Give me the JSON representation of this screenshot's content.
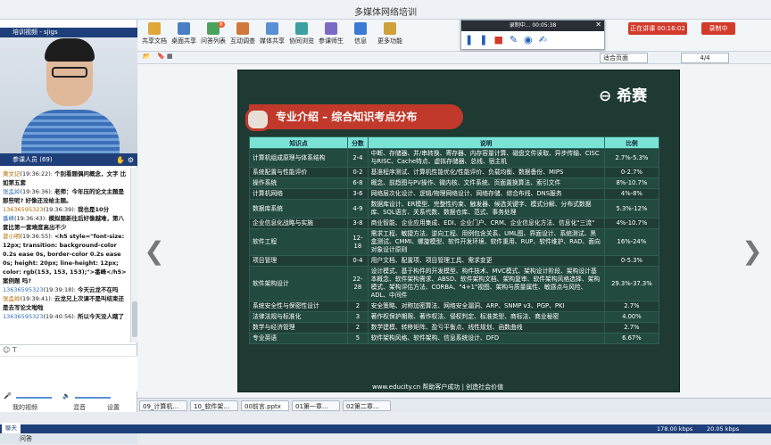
{
  "window": {
    "title": "多媒体网络培训"
  },
  "left_panel": {
    "video_title": "培训视频 - sjigs",
    "attendees_label": "参课人员 (69)",
    "chat": [
      {
        "name": "黄文记",
        "time": "(19:36:22):",
        "text": "个别看题偶问概念，文字 比如第五套"
      },
      {
        "name": "张孟岭",
        "time": "(19:36:36):",
        "text": "老师：今年压的论文主题是那些呢? 好像还没给主题。"
      },
      {
        "name": "13636595323",
        "time": "(19:36:39):",
        "text": "我也是10分"
      },
      {
        "name": "番峰",
        "time": "(19:36:43):",
        "text": "模拟题新往后好像越难，第八套比第一套难度高出不少"
      },
      {
        "name": "曾小明",
        "time": "(19:36:55):",
        "text": "<h5 style=\"font-size: 12px; transition: background-color 0.2s ease 0s, border-color 0.2s ease 0s; height: 20px; line-height: 12px; color: rgb(153, 153, 153);\">番峰</h5>案例题 吗?"
      },
      {
        "name": "13636595323",
        "time": "(19:39:18):",
        "text": "今天云龙不在吗"
      },
      {
        "name": "张孟岭",
        "time": "(19:39:41):",
        "text": "云龙兄上次课不是叫结束还是去写论文啦啦"
      },
      {
        "name": "13636595323",
        "time": "(19:40:56):",
        "text": "所以今天没人瞎了"
      }
    ],
    "input_icons": "☺ T",
    "my_video": "我的视频",
    "mix": "混音",
    "settings": "设置",
    "qa": "问答",
    "chat_tab": "聊天"
  },
  "toolbar": {
    "buttons": [
      "共享文档",
      "桌面共享",
      "问答列表",
      "互动调查",
      "媒体共享",
      "协同浏览",
      "参课师生",
      "信息",
      "更多功能"
    ],
    "badge": "8",
    "record_bar": "录制中... 00:05:38",
    "live_label": "正在讲课 00:16:02",
    "record_label": "录制中"
  },
  "nav": {
    "zoom": "适合页面",
    "page": "4/4"
  },
  "slide": {
    "logo": "希赛",
    "title": "专业介绍 – 综合知识考点分布",
    "headers": [
      "知识点",
      "分数",
      "说明",
      "比例"
    ],
    "rows": [
      [
        "计算机组成原理与体系结构",
        "2-4",
        "中断、存储器、并/串转换、寄存器、内存容量计算、磁盘文件读取、异步传输、CISC与RISC、Cache特点、虚拟存储器、总线、宿主机",
        "2.7%-5.3%"
      ],
      [
        "系统配置与性能评价",
        "0-2",
        "基准程序测试、计算机性能优化/性能评价、负载均衡、数据备份、MIPS",
        "0-2.7%"
      ],
      [
        "操作系统",
        "6-8",
        "概念、前趋图与PV操作、微内核、文件系统、页面置换算法、索引文件",
        "8%-10.7%"
      ],
      [
        "计算机网络",
        "3-6",
        "网络层次化设计、逻辑/物理网络设计、网络存储、综合布线、DNS服务",
        "4%-8%"
      ],
      [
        "数据库系统",
        "4-9",
        "数据库设计、ER模型、完整性约束、触发器、候选关键字、模式分解、分布式数据库、SQL语言、关系代数、数据仓库、范式、事务处理",
        "5.3%-12%"
      ],
      [
        "企业信息化战略与实施",
        "3-8",
        "商业智能、企业应用集成、EDI、企业门户、CRM、企业信息化方法、信息化\"三流\"",
        "4%-10.7%"
      ],
      [
        "软件工程",
        "12-18",
        "需求工程、敏捷方法、逆向工程、用例包含关系、UML图、界面设计、系统测试、黑盒测试、CMMI、螺旋模型、软件开发环境、软件重用、RUP、软件维护、RAD、面向对象设计原则",
        "16%-24%"
      ],
      [
        "项目管理",
        "0-4",
        "用户文档、配置项、项目管理工具、需求变更",
        "0-5.3%"
      ],
      [
        "软件架构设计",
        "22-28",
        "设计模式、基于构件的开发模型、构件技术、MVC模式、架构设计阶段、架构设计基本概念、软件架构需求、ABSD、软件架构文档、架构复审、软件架构风格选择、架构模式、架构评估方法、CORBA、\"4+1\"视图、架构与质量属性、敏感点与风险、ADL、中间件",
        "29.3%-37.3%"
      ],
      [
        "系统安全性与保密性设计",
        "2",
        "安全策略、对称加密算法、网络安全漏洞、ARP、SNMP v3、PGP、PKI",
        "2.7%"
      ],
      [
        "法律法规与标准化",
        "3",
        "著作权保护期限、著作权法、侵权判定、标准类型、商标法、商业秘密",
        "4.00%"
      ],
      [
        "数学与经济管理",
        "2",
        "数学建模、转移矩阵、盈亏平衡点、线性规划、函数曲线",
        "2.7%"
      ],
      [
        "专业英语",
        "5",
        "软件架构风格、软件架构、信息系统设计、DFD",
        "6.67%"
      ]
    ],
    "footer": "www.educity.cn  帮助客户成功 | 创造社会价值"
  },
  "tabs": [
    "09_计算机…",
    "10_软件架…",
    "00前言.pptx",
    "01第一章…",
    "02第二章…"
  ],
  "status": {
    "left": "",
    "upload": "178.00 kbps",
    "download": "20.05 kbps"
  }
}
